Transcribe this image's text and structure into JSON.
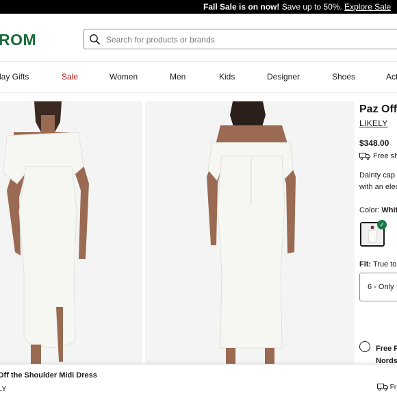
{
  "promo": {
    "bold": "Fall Sale is on now!",
    "text": " Save up to 50%. ",
    "link": "Explore Sale"
  },
  "header": {
    "logo": "ROM",
    "search_placeholder": "Search for products or brands"
  },
  "nav": [
    "day Gifts",
    "Sale",
    "Women",
    "Men",
    "Kids",
    "Designer",
    "Shoes",
    "Act"
  ],
  "product": {
    "title": "Paz Off",
    "brand": "LIKELY",
    "price": "$348.00",
    "shipping": "Free sh",
    "description": [
      "Dainty cap",
      "with an elec"
    ],
    "color_label": "Color:",
    "color_value": "Whit",
    "fit_label": "Fit:",
    "fit_value": "True to",
    "size_value": "6 - Only",
    "pickup_line1": "Free P",
    "pickup_line2": "Nords"
  },
  "sticky": {
    "name": "Off the Shoulder Midi Dress",
    "brand": "LY",
    "shipping": "Fr"
  },
  "colors": {
    "sale": "#b3120e",
    "logo": "#1a6b3a",
    "check": "#1b7a46"
  }
}
